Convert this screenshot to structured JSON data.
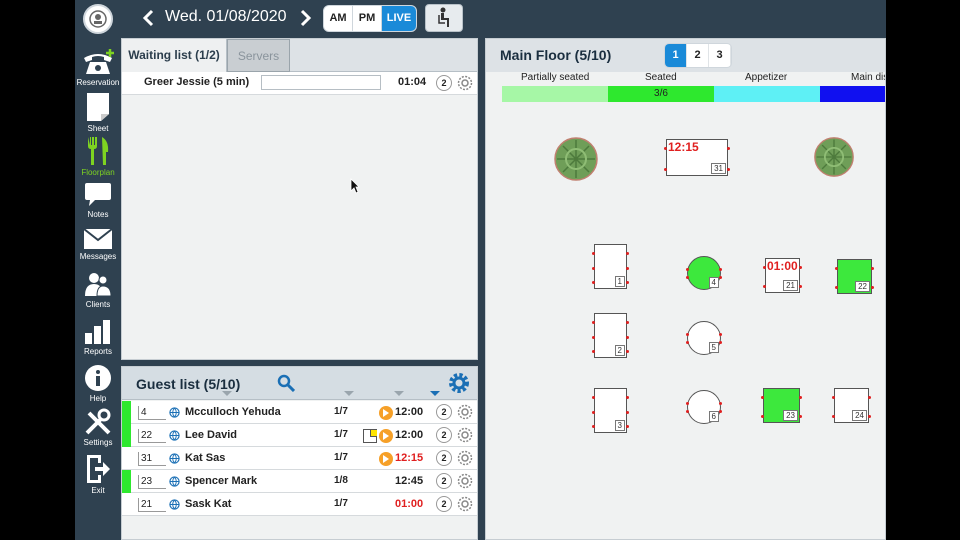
{
  "header": {
    "date": "Wed. 01/08/2020",
    "prev_icon": "chevron-left-icon",
    "next_icon": "chevron-right-icon",
    "modes": [
      "AM",
      "PM",
      "LIVE"
    ],
    "active_mode": "LIVE",
    "walkin_icon": "seated-person-icon"
  },
  "sidebar": {
    "items": [
      {
        "label": "Reservation",
        "icon": "phone-plus-icon"
      },
      {
        "label": "Sheet",
        "icon": "sheet-icon"
      },
      {
        "label": "Floorplan",
        "icon": "fork-knife-icon",
        "active": true
      },
      {
        "label": "Notes",
        "icon": "speech-bubble-icon"
      },
      {
        "label": "Messages",
        "icon": "envelope-icon"
      },
      {
        "label": "Clients",
        "icon": "people-icon"
      },
      {
        "label": "Reports",
        "icon": "bar-chart-icon"
      },
      {
        "label": "Help",
        "icon": "info-icon"
      },
      {
        "label": "Settings",
        "icon": "tools-icon"
      },
      {
        "label": "Exit",
        "icon": "exit-icon"
      }
    ]
  },
  "waiting": {
    "tabs": [
      "Waiting list (1/2)",
      "Servers"
    ],
    "rows": [
      {
        "name": "Greer Jessie (5 min)",
        "time": "01:04",
        "party": "2"
      }
    ]
  },
  "guests": {
    "title": "Guest list (5/10)",
    "rows": [
      {
        "table": "4",
        "name": "Mcculloch Yehuda",
        "frac": "1/7",
        "time": "12:00",
        "party": "2",
        "bar": "#2ee82e",
        "orange": true,
        "note": false,
        "red": false
      },
      {
        "table": "22",
        "name": "Lee David",
        "frac": "1/7",
        "time": "12:00",
        "party": "2",
        "bar": "#2ee82e",
        "orange": true,
        "note": true,
        "red": false
      },
      {
        "table": "31",
        "name": "Kat Sas",
        "frac": "1/7",
        "time": "12:15",
        "party": "2",
        "bar": "",
        "orange": true,
        "note": false,
        "red": true
      },
      {
        "table": "23",
        "name": "Spencer Mark",
        "frac": "1/8",
        "time": "12:45",
        "party": "2",
        "bar": "#2ee82e",
        "orange": false,
        "note": false,
        "red": false
      },
      {
        "table": "21",
        "name": "Sask Kat",
        "frac": "1/7",
        "time": "01:00",
        "party": "2",
        "bar": "",
        "orange": false,
        "note": false,
        "red": true
      }
    ]
  },
  "floor": {
    "title": "Main Floor (5/10)",
    "pages": [
      "1",
      "2",
      "3"
    ],
    "active_page": "1",
    "legend": [
      {
        "label": "Partially seated",
        "color": "#a6f7a6",
        "value": ""
      },
      {
        "label": "Seated",
        "color": "#2ee82e",
        "value": "3/6"
      },
      {
        "label": "Appetizer",
        "color": "#5ef0f5",
        "value": ""
      },
      {
        "label": "Main dis",
        "color": "#1010f0",
        "value": ""
      }
    ],
    "tables": [
      {
        "num": "31",
        "time": "12:15",
        "shape": "rect",
        "status": "reserved"
      },
      {
        "num": "1",
        "time": "",
        "shape": "rect",
        "status": "free"
      },
      {
        "num": "4",
        "time": "",
        "shape": "round",
        "status": "seated"
      },
      {
        "num": "21",
        "time": "01:00",
        "shape": "rect",
        "status": "reserved"
      },
      {
        "num": "22",
        "time": "",
        "shape": "rect",
        "status": "seated"
      },
      {
        "num": "2",
        "time": "",
        "shape": "rect",
        "status": "free"
      },
      {
        "num": "5",
        "time": "",
        "shape": "round",
        "status": "free"
      },
      {
        "num": "3",
        "time": "",
        "shape": "rect",
        "status": "free"
      },
      {
        "num": "6",
        "time": "",
        "shape": "round",
        "status": "free"
      },
      {
        "num": "23",
        "time": "",
        "shape": "rect",
        "status": "seated"
      },
      {
        "num": "24",
        "time": "",
        "shape": "rect",
        "status": "free"
      }
    ]
  }
}
